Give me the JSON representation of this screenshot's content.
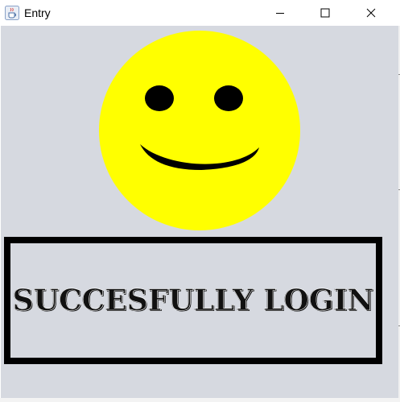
{
  "window": {
    "title": "Entry",
    "app_icon": "java-cup-icon",
    "controls": {
      "minimize_icon": "minimize-icon",
      "maximize_icon": "maximize-icon",
      "close_icon": "close-icon"
    }
  },
  "content": {
    "background_color": "#d6d9e0",
    "smiley": {
      "icon": "smiley-face-icon",
      "face_color": "#ffff00",
      "feature_color": "#000000"
    },
    "message_box": {
      "border_color": "#000000",
      "text": "SUCCESFULLY LOGIN"
    }
  }
}
